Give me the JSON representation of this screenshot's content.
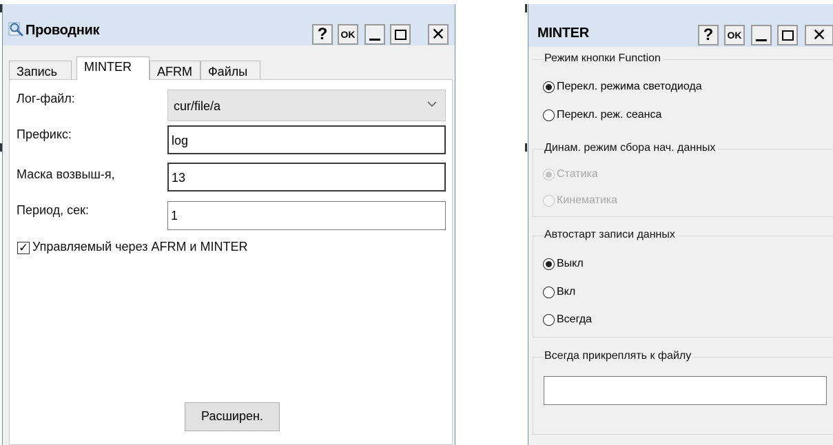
{
  "left_window": {
    "title": "Проводник",
    "icon": "magnifier-icon",
    "buttons": {
      "help": "?",
      "ok": "OK"
    },
    "tabs": [
      "Запись",
      "MINTER",
      "AFRM",
      "Файлы"
    ],
    "active_tab": "MINTER",
    "fields": {
      "log_file_label": "Лог-файл:",
      "log_file_value": "cur/file/a",
      "prefix_label": "Префикс:",
      "prefix_value": "log",
      "mask_label": "Маска возвыш-я,",
      "mask_value": "13",
      "period_label": "Период, сек:",
      "period_value": "1"
    },
    "checkbox": {
      "label": "Управляемый через AFRM и MINTER",
      "checked": true
    },
    "extended_button": "Расширен."
  },
  "right_window": {
    "title": "MINTER",
    "buttons": {
      "help": "?",
      "ok": "OK"
    },
    "function_mode": {
      "title": "Режим кнопки Function",
      "options": [
        "Перекл. режима светодиода",
        "Перекл. реж. сеанса"
      ],
      "selected": "Перекл. режима светодиода"
    },
    "dynamic_mode": {
      "title": "Динам. режим сбора нач. данных",
      "options": [
        "Статика",
        "Кинематика"
      ],
      "selected": "Статика",
      "disabled": true
    },
    "autostart": {
      "title": "Автостарт записи данных",
      "options": [
        "Выкл",
        "Вкл",
        "Всегда"
      ],
      "selected": "Выкл"
    },
    "attach": {
      "title": "Всегда прикреплять к файлу",
      "value": ""
    }
  }
}
